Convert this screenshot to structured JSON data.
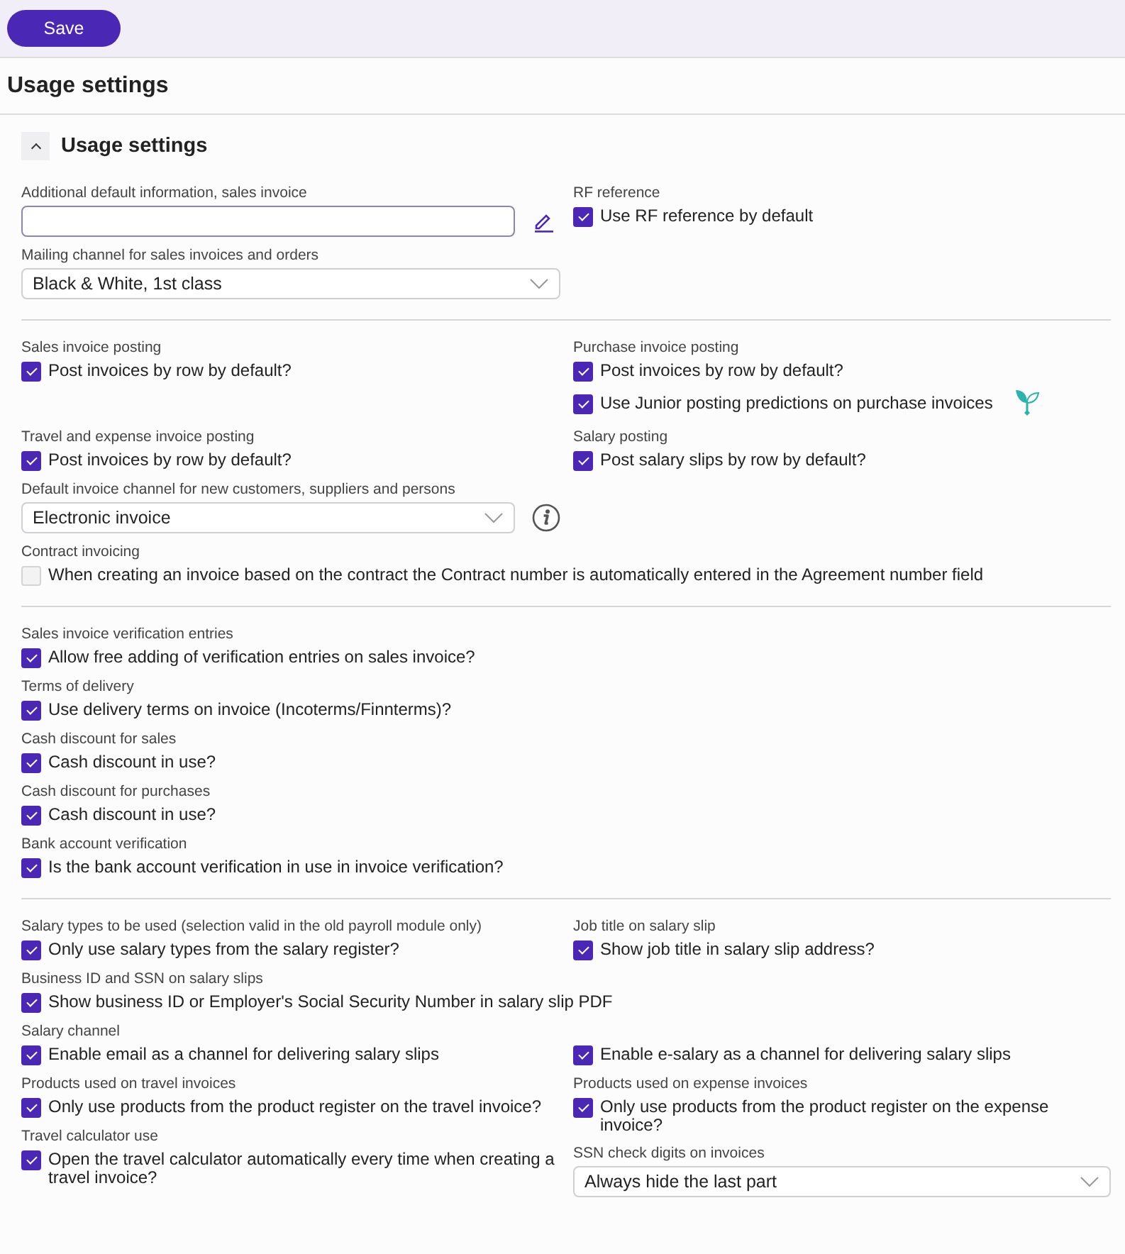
{
  "toolbar": {
    "save_button": "Save"
  },
  "page_title": "Usage settings",
  "panel": {
    "title": "Usage settings",
    "expanded": true,
    "sections": [
      {
        "rows": [
          {
            "left": [
              {
                "label": "Additional default information, sales invoice",
                "controls": [
                  {
                    "kind": "text",
                    "edit": true
                  }
                ]
              },
              {
                "label": "Mailing channel for sales invoices and orders",
                "controls": [
                  {
                    "kind": "select",
                    "value": "Black & White, 1st class",
                    "info": false
                  }
                ]
              }
            ],
            "right": [
              {
                "label": "RF reference",
                "controls": [
                  {
                    "kind": "checkbox",
                    "text": "Use RF reference by default",
                    "checked": true
                  }
                ]
              }
            ]
          }
        ]
      },
      {
        "rows": [
          {
            "left": [
              {
                "label": "Sales invoice posting",
                "controls": [
                  {
                    "kind": "checkbox",
                    "text": "Post invoices by row by default?",
                    "checked": true
                  }
                ]
              }
            ],
            "right": [
              {
                "label": "Purchase invoice posting",
                "controls": [
                  {
                    "kind": "checkbox",
                    "text": "Post invoices by row by default?",
                    "checked": true
                  },
                  {
                    "kind": "checkbox",
                    "text": "Use Junior posting predictions on purchase invoices",
                    "checked": true,
                    "ai_badge": true
                  }
                ]
              }
            ]
          },
          {
            "left": [
              {
                "label": "Travel and expense invoice posting",
                "controls": [
                  {
                    "kind": "checkbox",
                    "text": "Post invoices by row by default?",
                    "checked": true
                  }
                ]
              }
            ],
            "right": [
              {
                "label": "Salary posting",
                "controls": [
                  {
                    "kind": "checkbox",
                    "text": "Post salary slips by row by default?",
                    "checked": true
                  }
                ]
              }
            ]
          },
          {
            "left": [
              {
                "label": "Default invoice channel for new customers, suppliers and persons",
                "controls": [
                  {
                    "kind": "select",
                    "value": "Electronic invoice",
                    "info": true
                  }
                ]
              }
            ]
          },
          {
            "full": [
              {
                "label": "Contract invoicing",
                "controls": [
                  {
                    "kind": "checkbox",
                    "text": "When creating an invoice based on the contract the Contract number is automatically entered in the Agreement number field",
                    "checked": false
                  }
                ]
              }
            ]
          }
        ]
      },
      {
        "rows": [
          {
            "left": [
              {
                "label": "Sales invoice verification entries",
                "controls": [
                  {
                    "kind": "checkbox",
                    "text": "Allow free adding of verification entries on sales invoice?",
                    "checked": true
                  }
                ]
              }
            ]
          },
          {
            "left": [
              {
                "label": "Terms of delivery",
                "controls": [
                  {
                    "kind": "checkbox",
                    "text": "Use delivery terms on invoice (Incoterms/Finnterms)?",
                    "checked": true
                  }
                ]
              }
            ]
          },
          {
            "left": [
              {
                "label": "Cash discount for sales",
                "controls": [
                  {
                    "kind": "checkbox",
                    "text": "Cash discount in use?",
                    "checked": true
                  }
                ]
              }
            ]
          },
          {
            "left": [
              {
                "label": "Cash discount for purchases",
                "controls": [
                  {
                    "kind": "checkbox",
                    "text": "Cash discount in use?",
                    "checked": true
                  }
                ]
              }
            ]
          },
          {
            "left": [
              {
                "label": "Bank account verification",
                "controls": [
                  {
                    "kind": "checkbox",
                    "text": "Is the bank account verification in use in invoice verification?",
                    "checked": true
                  }
                ]
              }
            ]
          }
        ]
      },
      {
        "rows": [
          {
            "left": [
              {
                "label": "Salary types to be used (selection valid in the old payroll module only)",
                "controls": [
                  {
                    "kind": "checkbox",
                    "text": "Only use salary types from the salary register?",
                    "checked": true
                  }
                ]
              }
            ],
            "right": [
              {
                "label": "Job title on salary slip",
                "controls": [
                  {
                    "kind": "checkbox",
                    "text": "Show job title in salary slip address?",
                    "checked": true
                  }
                ]
              }
            ]
          },
          {
            "full": [
              {
                "label": "Business ID and SSN on salary slips",
                "controls": [
                  {
                    "kind": "checkbox",
                    "text": "Show business ID or Employer's Social Security Number in salary slip PDF",
                    "checked": true
                  }
                ]
              }
            ]
          },
          {
            "left": [
              {
                "label": "Salary channel",
                "controls": [
                  {
                    "kind": "checkbox",
                    "text": "Enable email as a channel for delivering salary slips",
                    "checked": true
                  }
                ]
              },
              {
                "label": "Products used on travel invoices",
                "controls": [
                  {
                    "kind": "checkbox",
                    "text": "Only use products from the product register on the travel invoice?",
                    "checked": true
                  }
                ]
              },
              {
                "label": "Travel calculator use",
                "controls": [
                  {
                    "kind": "checkbox",
                    "text": "Open the travel calculator automatically every time when creating a travel invoice?",
                    "checked": true
                  }
                ]
              }
            ],
            "right": [
              {
                "controls": [
                  {
                    "kind": "checkbox",
                    "text": "Enable e-salary as a channel for delivering salary slips",
                    "checked": true
                  }
                ]
              },
              {
                "label": "Products used on expense invoices",
                "controls": [
                  {
                    "kind": "checkbox",
                    "text": "Only use products from the product register on the expense invoice?",
                    "checked": true
                  }
                ]
              },
              {
                "label": "SSN check digits on invoices",
                "controls": [
                  {
                    "kind": "select",
                    "value": "Always hide the last part",
                    "info": false
                  }
                ]
              }
            ]
          }
        ]
      }
    ]
  }
}
